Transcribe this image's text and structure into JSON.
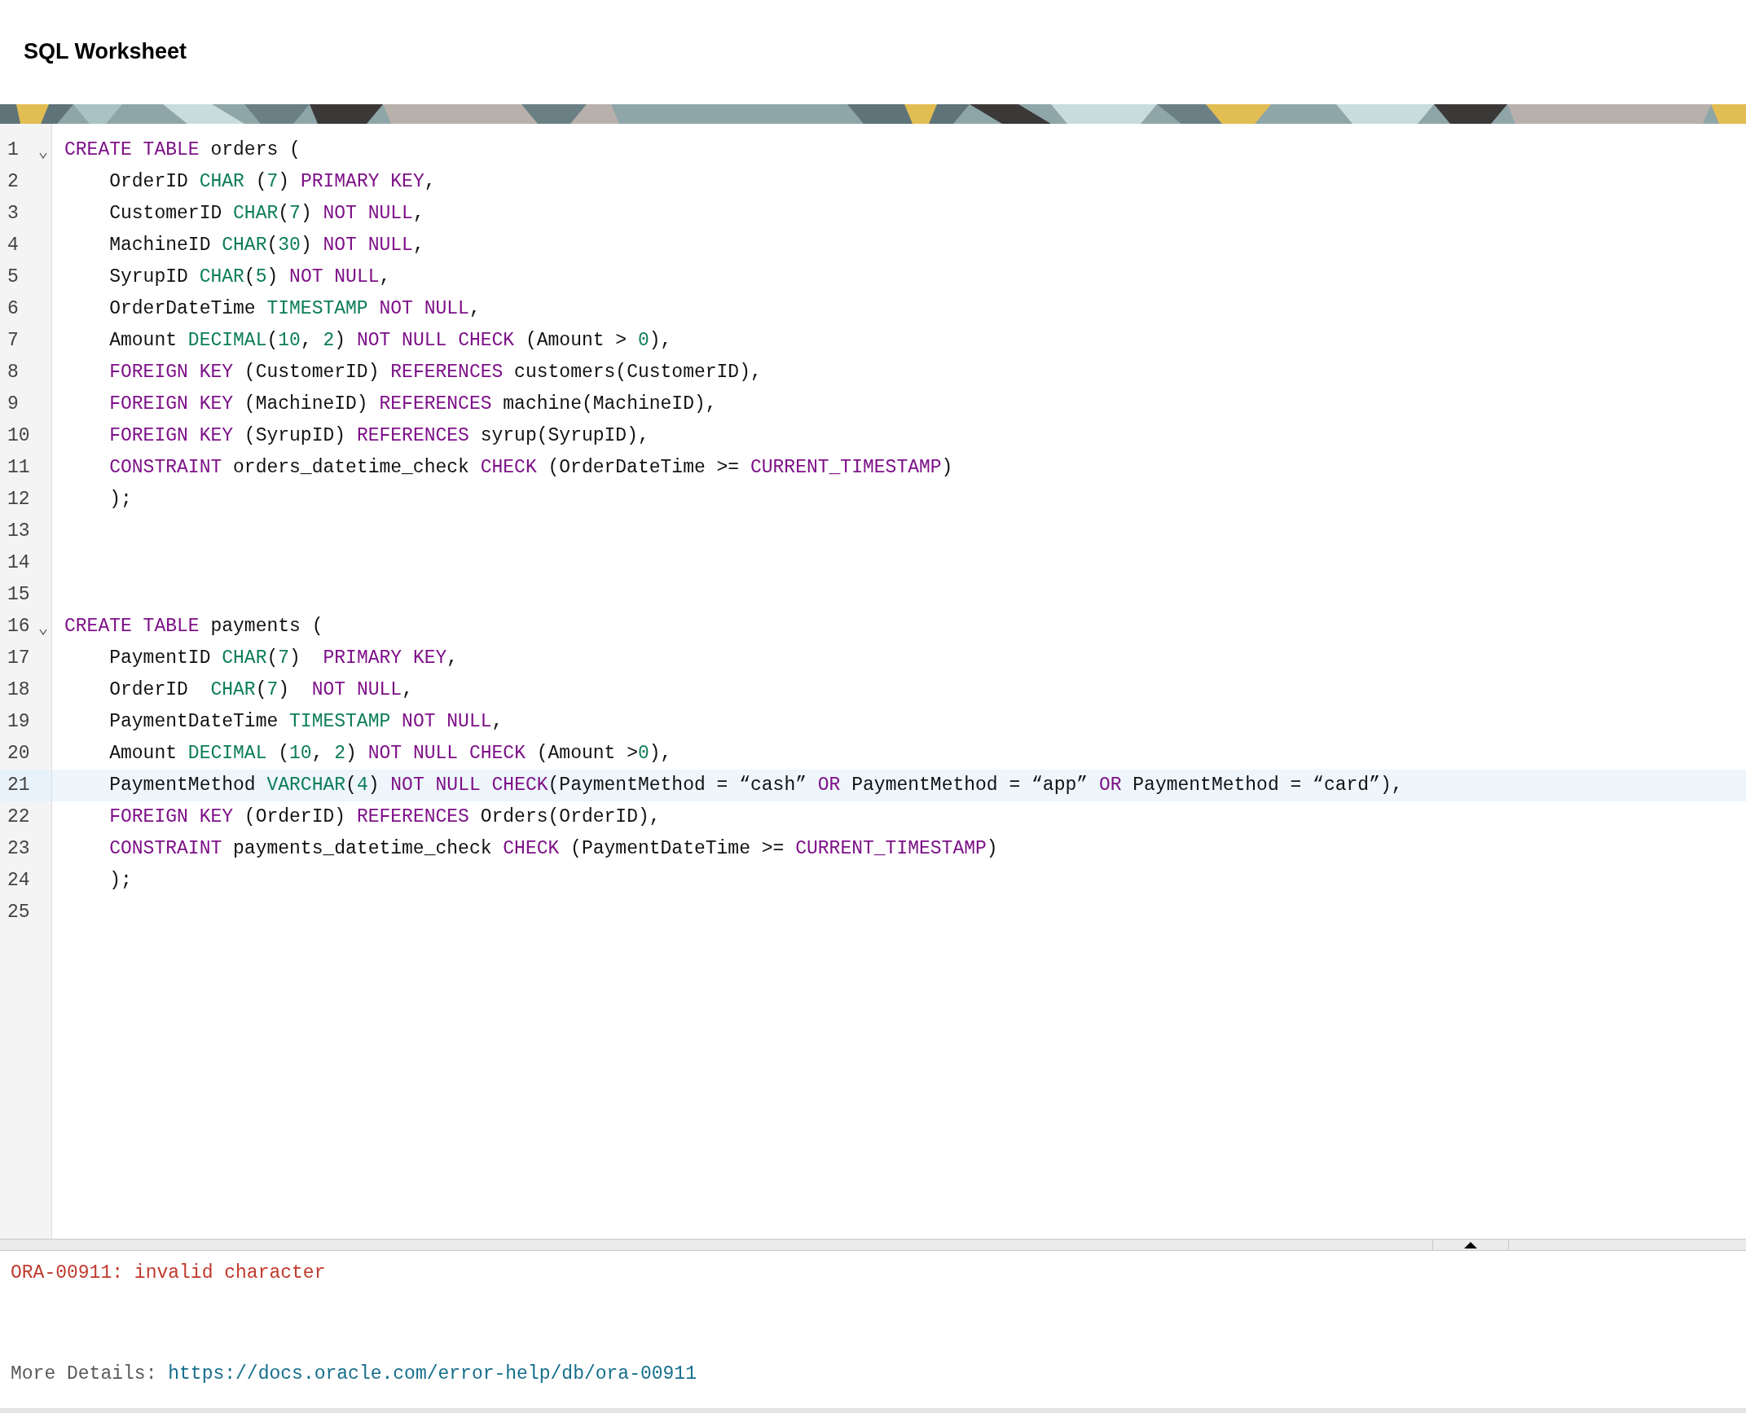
{
  "title": "SQL Worksheet",
  "editor": {
    "lines": [
      {
        "number": "1",
        "fold": true,
        "current": false,
        "tokens": [
          {
            "text": "CREATE TABLE",
            "kind": "kw"
          },
          {
            "text": " orders (",
            "kind": "plain"
          }
        ]
      },
      {
        "number": "2",
        "fold": false,
        "current": false,
        "tokens": [
          {
            "text": "    OrderID ",
            "kind": "plain"
          },
          {
            "text": "CHAR",
            "kind": "type"
          },
          {
            "text": " (",
            "kind": "plain"
          },
          {
            "text": "7",
            "kind": "num"
          },
          {
            "text": ") ",
            "kind": "plain"
          },
          {
            "text": "PRIMARY KEY",
            "kind": "kw"
          },
          {
            "text": ",",
            "kind": "plain"
          }
        ]
      },
      {
        "number": "3",
        "fold": false,
        "current": false,
        "tokens": [
          {
            "text": "    CustomerID ",
            "kind": "plain"
          },
          {
            "text": "CHAR",
            "kind": "type"
          },
          {
            "text": "(",
            "kind": "plain"
          },
          {
            "text": "7",
            "kind": "num"
          },
          {
            "text": ") ",
            "kind": "plain"
          },
          {
            "text": "NOT NULL",
            "kind": "kw"
          },
          {
            "text": ",",
            "kind": "plain"
          }
        ]
      },
      {
        "number": "4",
        "fold": false,
        "current": false,
        "tokens": [
          {
            "text": "    MachineID ",
            "kind": "plain"
          },
          {
            "text": "CHAR",
            "kind": "type"
          },
          {
            "text": "(",
            "kind": "plain"
          },
          {
            "text": "30",
            "kind": "num"
          },
          {
            "text": ") ",
            "kind": "plain"
          },
          {
            "text": "NOT NULL",
            "kind": "kw"
          },
          {
            "text": ",",
            "kind": "plain"
          }
        ]
      },
      {
        "number": "5",
        "fold": false,
        "current": false,
        "tokens": [
          {
            "text": "    SyrupID ",
            "kind": "plain"
          },
          {
            "text": "CHAR",
            "kind": "type"
          },
          {
            "text": "(",
            "kind": "plain"
          },
          {
            "text": "5",
            "kind": "num"
          },
          {
            "text": ") ",
            "kind": "plain"
          },
          {
            "text": "NOT NULL",
            "kind": "kw"
          },
          {
            "text": ",",
            "kind": "plain"
          }
        ]
      },
      {
        "number": "6",
        "fold": false,
        "current": false,
        "tokens": [
          {
            "text": "    OrderDateTime ",
            "kind": "plain"
          },
          {
            "text": "TIMESTAMP",
            "kind": "type"
          },
          {
            "text": " NOT NULL",
            "kind": "kw"
          },
          {
            "text": ",",
            "kind": "plain"
          }
        ]
      },
      {
        "number": "7",
        "fold": false,
        "current": false,
        "tokens": [
          {
            "text": "    Amount ",
            "kind": "plain"
          },
          {
            "text": "DECIMAL",
            "kind": "type"
          },
          {
            "text": "(",
            "kind": "plain"
          },
          {
            "text": "10",
            "kind": "num"
          },
          {
            "text": ", ",
            "kind": "plain"
          },
          {
            "text": "2",
            "kind": "num"
          },
          {
            "text": ") ",
            "kind": "plain"
          },
          {
            "text": "NOT NULL CHECK",
            "kind": "kw"
          },
          {
            "text": " (Amount > ",
            "kind": "plain"
          },
          {
            "text": "0",
            "kind": "num"
          },
          {
            "text": "),",
            "kind": "plain"
          }
        ]
      },
      {
        "number": "8",
        "fold": false,
        "current": false,
        "tokens": [
          {
            "text": "    FOREIGN KEY",
            "kind": "kw"
          },
          {
            "text": " (CustomerID) ",
            "kind": "plain"
          },
          {
            "text": "REFERENCES",
            "kind": "kw"
          },
          {
            "text": " customers(CustomerID),",
            "kind": "plain"
          }
        ]
      },
      {
        "number": "9",
        "fold": false,
        "current": false,
        "tokens": [
          {
            "text": "    FOREIGN KEY",
            "kind": "kw"
          },
          {
            "text": " (MachineID) ",
            "kind": "plain"
          },
          {
            "text": "REFERENCES",
            "kind": "kw"
          },
          {
            "text": " machine(MachineID),",
            "kind": "plain"
          }
        ]
      },
      {
        "number": "10",
        "fold": false,
        "current": false,
        "tokens": [
          {
            "text": "    FOREIGN KEY",
            "kind": "kw"
          },
          {
            "text": " (SyrupID) ",
            "kind": "plain"
          },
          {
            "text": "REFERENCES",
            "kind": "kw"
          },
          {
            "text": " syrup(SyrupID),",
            "kind": "plain"
          }
        ]
      },
      {
        "number": "11",
        "fold": false,
        "current": false,
        "tokens": [
          {
            "text": "    CONSTRAINT",
            "kind": "kw"
          },
          {
            "text": " orders_datetime_check ",
            "kind": "plain"
          },
          {
            "text": "CHECK",
            "kind": "kw"
          },
          {
            "text": " (OrderDateTime >= ",
            "kind": "plain"
          },
          {
            "text": "CURRENT_TIMESTAMP",
            "kind": "kw"
          },
          {
            "text": ")",
            "kind": "plain"
          }
        ]
      },
      {
        "number": "12",
        "fold": false,
        "current": false,
        "tokens": [
          {
            "text": "    );",
            "kind": "plain"
          }
        ]
      },
      {
        "number": "13",
        "fold": false,
        "current": false
      },
      {
        "number": "14",
        "fold": false,
        "current": false
      },
      {
        "number": "15",
        "fold": false,
        "current": false
      },
      {
        "number": "16",
        "fold": true,
        "current": false,
        "tokens": [
          {
            "text": "CREATE TABLE",
            "kind": "kw"
          },
          {
            "text": " payments (",
            "kind": "plain"
          }
        ]
      },
      {
        "number": "17",
        "fold": false,
        "current": false,
        "tokens": [
          {
            "text": "    PaymentID ",
            "kind": "plain"
          },
          {
            "text": "CHAR",
            "kind": "type"
          },
          {
            "text": "(",
            "kind": "plain"
          },
          {
            "text": "7",
            "kind": "num"
          },
          {
            "text": ")  ",
            "kind": "plain"
          },
          {
            "text": "PRIMARY KEY",
            "kind": "kw"
          },
          {
            "text": ",",
            "kind": "plain"
          }
        ]
      },
      {
        "number": "18",
        "fold": false,
        "current": false,
        "tokens": [
          {
            "text": "    OrderID  ",
            "kind": "plain"
          },
          {
            "text": "CHAR",
            "kind": "type"
          },
          {
            "text": "(",
            "kind": "plain"
          },
          {
            "text": "7",
            "kind": "num"
          },
          {
            "text": ")  ",
            "kind": "plain"
          },
          {
            "text": "NOT NULL",
            "kind": "kw"
          },
          {
            "text": ",",
            "kind": "plain"
          }
        ]
      },
      {
        "number": "19",
        "fold": false,
        "current": false,
        "tokens": [
          {
            "text": "    PaymentDateTime ",
            "kind": "plain"
          },
          {
            "text": "TIMESTAMP",
            "kind": "type"
          },
          {
            "text": " NOT NULL",
            "kind": "kw"
          },
          {
            "text": ",",
            "kind": "plain"
          }
        ]
      },
      {
        "number": "20",
        "fold": false,
        "current": false,
        "tokens": [
          {
            "text": "    Amount ",
            "kind": "plain"
          },
          {
            "text": "DECIMAL",
            "kind": "type"
          },
          {
            "text": " (",
            "kind": "plain"
          },
          {
            "text": "10",
            "kind": "num"
          },
          {
            "text": ", ",
            "kind": "plain"
          },
          {
            "text": "2",
            "kind": "num"
          },
          {
            "text": ") ",
            "kind": "plain"
          },
          {
            "text": "NOT NULL CHECK",
            "kind": "kw"
          },
          {
            "text": " (Amount >",
            "kind": "plain"
          },
          {
            "text": "0",
            "kind": "num"
          },
          {
            "text": "),",
            "kind": "plain"
          }
        ]
      },
      {
        "number": "21",
        "fold": false,
        "current": true,
        "tokens": [
          {
            "text": "    PaymentMethod ",
            "kind": "plain"
          },
          {
            "text": "VARCHAR",
            "kind": "type"
          },
          {
            "text": "(",
            "kind": "plain"
          },
          {
            "text": "4",
            "kind": "num"
          },
          {
            "text": ") ",
            "kind": "plain"
          },
          {
            "text": "NOT NULL CHECK",
            "kind": "kw"
          },
          {
            "text": "(PaymentMethod = “cash” ",
            "kind": "plain"
          },
          {
            "text": "OR",
            "kind": "kw"
          },
          {
            "text": " PaymentMethod = “app” ",
            "kind": "plain"
          },
          {
            "text": "OR",
            "kind": "kw"
          },
          {
            "text": " PaymentMethod = “card”),",
            "kind": "plain"
          }
        ]
      },
      {
        "number": "22",
        "fold": false,
        "current": false,
        "tokens": [
          {
            "text": "    FOREIGN KEY",
            "kind": "kw"
          },
          {
            "text": " (OrderID) ",
            "kind": "plain"
          },
          {
            "text": "REFERENCES",
            "kind": "kw"
          },
          {
            "text": " Orders(OrderID),",
            "kind": "plain"
          }
        ]
      },
      {
        "number": "23",
        "fold": false,
        "current": false,
        "tokens": [
          {
            "text": "    CONSTRAINT",
            "kind": "kw"
          },
          {
            "text": " payments_datetime_check ",
            "kind": "plain"
          },
          {
            "text": "CHECK",
            "kind": "kw"
          },
          {
            "text": " (PaymentDateTime >= ",
            "kind": "plain"
          },
          {
            "text": "CURRENT_TIMESTAMP",
            "kind": "kw"
          },
          {
            "text": ")",
            "kind": "plain"
          }
        ]
      },
      {
        "number": "24",
        "fold": false,
        "current": false,
        "tokens": [
          {
            "text": "    );",
            "kind": "plain"
          }
        ]
      },
      {
        "number": "25",
        "fold": false,
        "current": false
      }
    ]
  },
  "output": {
    "error": "ORA-00911: invalid character",
    "details_label": "More Details:",
    "details_link": "https://docs.oracle.com/error-help/db/ora-00911"
  }
}
